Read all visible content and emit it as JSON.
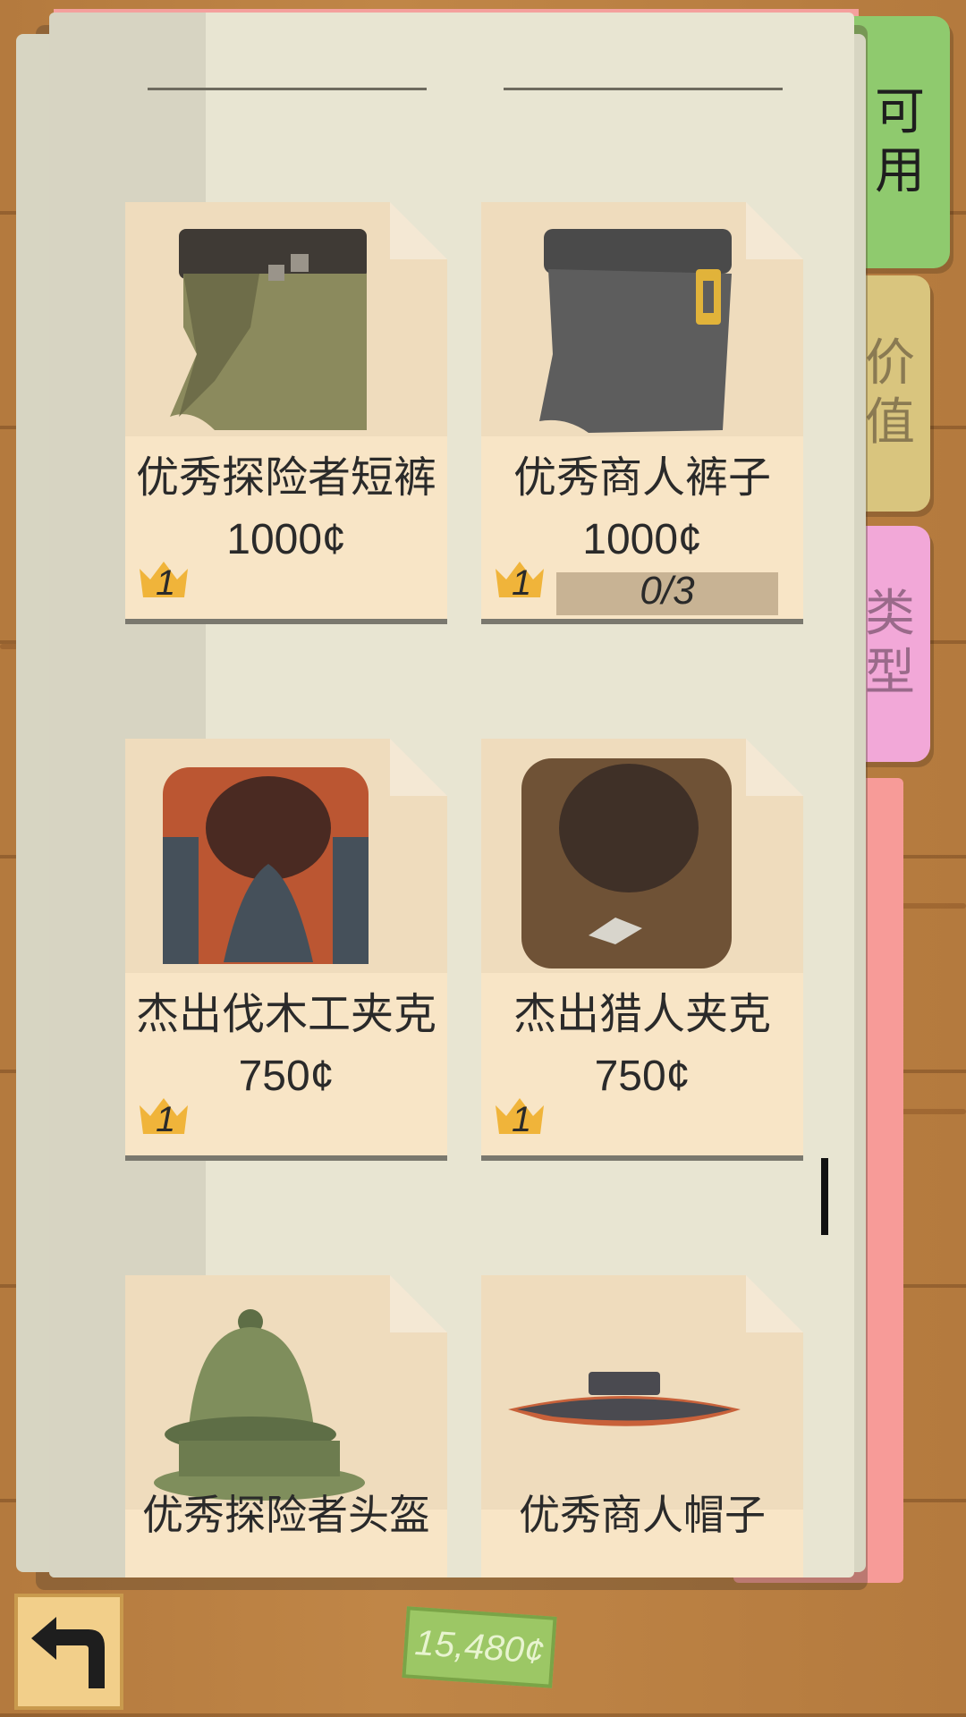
{
  "tabs": [
    {
      "label_1": "可",
      "label_2": "用",
      "color": "#8fca6e"
    },
    {
      "label_1": "价",
      "label_2": "值",
      "color": "#d9c57e"
    },
    {
      "label_1": "类",
      "label_2": "型",
      "color": "#f2a8d8"
    }
  ],
  "items": [
    {
      "name": "优秀探险者短裤",
      "price": "1000¢",
      "level": "1",
      "icon": "explorer-shorts-icon"
    },
    {
      "name": "优秀商人裤子",
      "price": "1000¢",
      "level": "1",
      "progress": "0/3",
      "progress_fraction": 0,
      "icon": "merchant-pants-icon"
    },
    {
      "name": "杰出伐木工夹克",
      "price": "750¢",
      "level": "1",
      "icon": "lumberjack-jacket-icon"
    },
    {
      "name": "杰出猎人夹克",
      "price": "750¢",
      "level": "1",
      "icon": "hunter-jacket-icon"
    },
    {
      "name": "优秀探险者头盔",
      "icon": "explorer-helmet-icon"
    },
    {
      "name": "优秀商人帽子",
      "icon": "merchant-hat-icon"
    }
  ],
  "footer": {
    "money": "15,480¢",
    "back_icon": "back-arrow-icon"
  }
}
